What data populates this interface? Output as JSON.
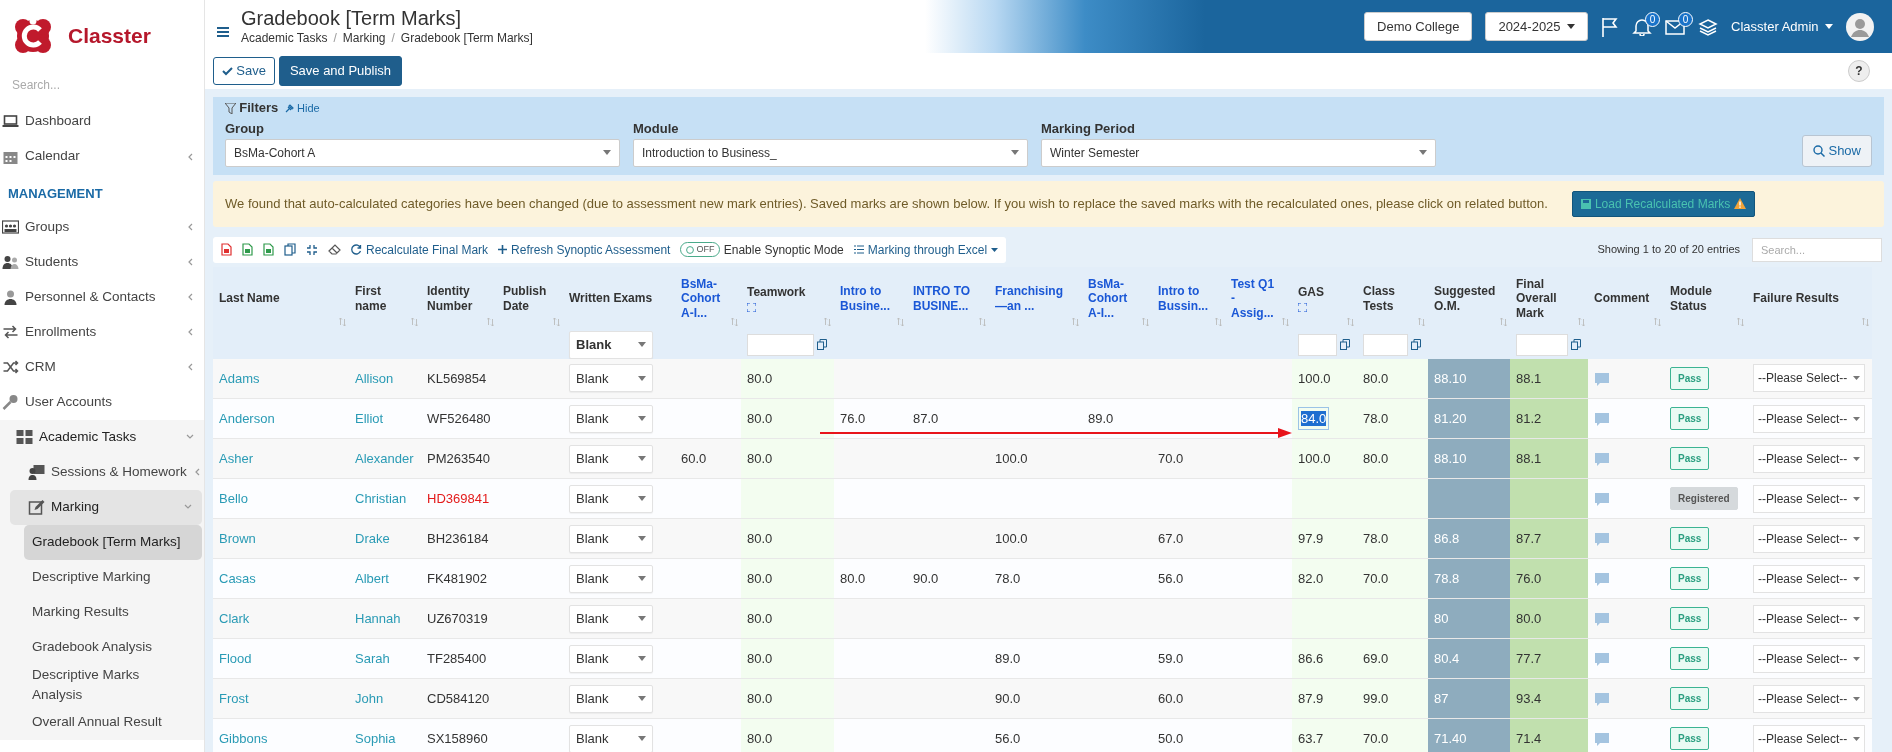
{
  "sidebar": {
    "brand": "Classter",
    "search_placeholder": "Search...",
    "items": [
      {
        "label": "Dashboard",
        "kind": "item",
        "selected": false
      },
      {
        "label": "Calendar",
        "kind": "item",
        "expanded": false,
        "selected": false
      },
      {
        "label": "MANAGEMENT",
        "kind": "section"
      },
      {
        "label": "Groups",
        "kind": "item",
        "expanded": false,
        "selected": false
      },
      {
        "label": "Students",
        "kind": "item",
        "expanded": false,
        "selected": false
      },
      {
        "label": "Personnel & Contacts",
        "kind": "item",
        "expanded": false,
        "selected": false
      },
      {
        "label": "Enrollments",
        "kind": "item",
        "expanded": false,
        "selected": false
      },
      {
        "label": "CRM",
        "kind": "item",
        "expanded": false,
        "selected": false
      },
      {
        "label": "User Accounts",
        "kind": "item",
        "selected": false
      },
      {
        "label": "Academic Tasks",
        "kind": "item",
        "expanded": true,
        "selected": false,
        "children": [
          {
            "label": "Sessions & Homework",
            "kind": "item",
            "expanded": false,
            "selected": false
          },
          {
            "label": "Marking",
            "kind": "item",
            "expanded": true,
            "selected": false,
            "children": [
              {
                "label": "Gradebook [Term Marks]",
                "kind": "item",
                "selected": true
              },
              {
                "label": "Descriptive Marking",
                "kind": "item",
                "selected": false
              },
              {
                "label": "Marking Results",
                "kind": "item",
                "selected": false
              },
              {
                "label": "Gradebook Analysis",
                "kind": "item",
                "selected": false
              },
              {
                "label": "Descriptive Marks Analysis",
                "kind": "item",
                "selected": false
              },
              {
                "label": "Overall Annual Result",
                "kind": "item",
                "selected": false
              }
            ]
          }
        ]
      }
    ]
  },
  "header": {
    "title": "Gradebook [Term Marks]",
    "breadcrumb": [
      {
        "label": "Academic Tasks",
        "separator": "/"
      },
      {
        "label": "Marking",
        "separator": "/"
      },
      {
        "label": "Gradebook [Term Marks]"
      }
    ],
    "college": "Demo College",
    "year": "2024-2025",
    "notifications": "0",
    "messages": "0",
    "user": "Classter Admin"
  },
  "actions": {
    "save": "Save",
    "save_publish": "Save and Publish",
    "help": "?"
  },
  "filters": {
    "title": "Filters",
    "hide": "Hide",
    "fields": [
      {
        "label": "Group",
        "value": "BsMa-Cohort A"
      },
      {
        "label": "Module",
        "value": "Introduction to Business_"
      },
      {
        "label": "Marking Period",
        "value": "Winter Semester"
      }
    ],
    "show": "Show"
  },
  "alert": {
    "text": "We found that auto-calculated categories have been changed (due to assessment new mark entries). Saved marks are shown below. If you wish to replace the saved marks with the recalculated ones, please click on related button.",
    "button": "Load Recalculated Marks"
  },
  "toolbar": {
    "recalculate": "Recalculate Final Mark",
    "refresh": "Refresh Synoptic Assessment",
    "synoptic": {
      "label": "Enable Synoptic Mode",
      "state_text": "OFF",
      "on": false
    },
    "excel": "Marking through Excel",
    "info": "Showing 1 to 20 of 20 entries",
    "search_placeholder": "Search..."
  },
  "table": {
    "columns": [
      {
        "label": "Last Name",
        "kind": "plain",
        "sortable": true,
        "expand": false
      },
      {
        "label": "First name",
        "kind": "plain",
        "sortable": true,
        "expand": false
      },
      {
        "label": "Identity Number",
        "kind": "plain",
        "sortable": true,
        "expand": false
      },
      {
        "label": "Publish Date",
        "kind": "plain",
        "sortable": true,
        "expand": false
      },
      {
        "label": "Written Exams",
        "kind": "plain",
        "sortable": false,
        "expand": false,
        "filter": {
          "kind": "select",
          "value": "Blank"
        }
      },
      {
        "label": "BsMa-Cohort A-I...",
        "kind": "link",
        "sortable": true,
        "expand": false
      },
      {
        "label": "Teamwork",
        "kind": "graded",
        "sortable": true,
        "expand": true,
        "filter": {
          "kind": "input"
        }
      },
      {
        "label": "Intro to Busine...",
        "kind": "link",
        "sortable": true,
        "expand": false
      },
      {
        "label": "INTRO TO BUSINE...",
        "kind": "link",
        "sortable": true,
        "expand": false
      },
      {
        "label": "Franchising —an ...",
        "kind": "link",
        "sortable": true,
        "expand": false
      },
      {
        "label": "BsMa-Cohort A-I...",
        "kind": "link",
        "sortable": true,
        "expand": false
      },
      {
        "label": "Intro to Bussin...",
        "kind": "link",
        "sortable": true,
        "expand": false
      },
      {
        "label": "Test Q1 - Assig...",
        "kind": "link",
        "sortable": true,
        "expand": false
      },
      {
        "label": "GAS",
        "kind": "graded",
        "sortable": true,
        "expand": true,
        "filter": {
          "kind": "input"
        }
      },
      {
        "label": "Class Tests",
        "kind": "graded",
        "sortable": true,
        "expand": false,
        "filter": {
          "kind": "input"
        }
      },
      {
        "label": "Suggested O.M.",
        "kind": "suggested",
        "sortable": true,
        "expand": false
      },
      {
        "label": "Final Overall Mark",
        "kind": "final",
        "sortable": true,
        "expand": false,
        "filter": {
          "kind": "input"
        }
      },
      {
        "label": "Comment",
        "kind": "plain",
        "sortable": true,
        "expand": false
      },
      {
        "label": "Module Status",
        "kind": "plain",
        "sortable": true,
        "expand": false
      },
      {
        "label": "Failure Results",
        "kind": "plain",
        "sortable": true,
        "expand": false
      }
    ],
    "rows": [
      {
        "last_name": "Adams",
        "first_name": "Allison",
        "identity": "KL569854",
        "identity_flagged": false,
        "written": "Blank",
        "marks": {
          "teamwork": "80.0",
          "gas": "100.0",
          "class_tests": "80.0"
        },
        "gas_focused": false,
        "annotated": false,
        "suggested": "88.10",
        "final": "88.1",
        "status": {
          "text": "Pass",
          "kind": "pass"
        },
        "failure": "--Please Select--"
      },
      {
        "last_name": "Anderson",
        "first_name": "Elliot",
        "identity": "WF526480",
        "identity_flagged": false,
        "written": "Blank",
        "marks": {
          "teamwork": "80.0",
          "intro_to_busine": "76.0",
          "intro_to_busine_upper": "87.0",
          "bsma_cohort_a_second": "89.0",
          "gas": "84.0",
          "class_tests": "78.0"
        },
        "gas_focused": true,
        "annotated": true,
        "suggested": "81.20",
        "final": "81.2",
        "status": {
          "text": "Pass",
          "kind": "pass"
        },
        "failure": "--Please Select--"
      },
      {
        "last_name": "Asher",
        "first_name": "Alexander",
        "identity": "PM263540",
        "identity_flagged": false,
        "written": "Blank",
        "marks": {
          "bsma_cohort_a": "60.0",
          "teamwork": "80.0",
          "franchising": "100.0",
          "intro_to_bussin": "70.0",
          "gas": "100.0",
          "class_tests": "80.0"
        },
        "gas_focused": false,
        "annotated": false,
        "suggested": "88.10",
        "final": "88.1",
        "status": {
          "text": "Pass",
          "kind": "pass"
        },
        "failure": "--Please Select--"
      },
      {
        "last_name": "Bello",
        "first_name": "Christian",
        "identity": "HD369841",
        "identity_flagged": true,
        "written": "Blank",
        "gas_focused": false,
        "annotated": false,
        "status": {
          "text": "Registered",
          "kind": "registered"
        },
        "failure": "--Please Select--"
      },
      {
        "last_name": "Brown",
        "first_name": "Drake",
        "identity": "BH236184",
        "identity_flagged": false,
        "written": "Blank",
        "marks": {
          "teamwork": "80.0",
          "franchising": "100.0",
          "intro_to_bussin": "67.0",
          "gas": "97.9",
          "class_tests": "78.0"
        },
        "gas_focused": false,
        "annotated": false,
        "suggested": "86.8",
        "final": "87.7",
        "status": {
          "text": "Pass",
          "kind": "pass"
        },
        "failure": "--Please Select--"
      },
      {
        "last_name": "Casas",
        "first_name": "Albert",
        "identity": "FK481902",
        "identity_flagged": false,
        "written": "Blank",
        "marks": {
          "teamwork": "80.0",
          "intro_to_busine": "80.0",
          "intro_to_busine_upper": "90.0",
          "franchising": "78.0",
          "intro_to_bussin": "56.0",
          "gas": "82.0",
          "class_tests": "70.0"
        },
        "gas_focused": false,
        "annotated": false,
        "suggested": "78.8",
        "final": "76.0",
        "status": {
          "text": "Pass",
          "kind": "pass"
        },
        "failure": "--Please Select--"
      },
      {
        "last_name": "Clark",
        "first_name": "Hannah",
        "identity": "UZ670319",
        "identity_flagged": false,
        "written": "Blank",
        "marks": {
          "teamwork": "80.0"
        },
        "gas_focused": false,
        "annotated": false,
        "suggested": "80",
        "final": "80.0",
        "status": {
          "text": "Pass",
          "kind": "pass"
        },
        "failure": "--Please Select--"
      },
      {
        "last_name": "Flood",
        "first_name": "Sarah",
        "identity": "TF285400",
        "identity_flagged": false,
        "written": "Blank",
        "marks": {
          "teamwork": "80.0",
          "franchising": "89.0",
          "intro_to_bussin": "59.0",
          "gas": "86.6",
          "class_tests": "69.0"
        },
        "gas_focused": false,
        "annotated": false,
        "suggested": "80.4",
        "final": "77.7",
        "status": {
          "text": "Pass",
          "kind": "pass"
        },
        "failure": "--Please Select--"
      },
      {
        "last_name": "Frost",
        "first_name": "John",
        "identity": "CD584120",
        "identity_flagged": false,
        "written": "Blank",
        "marks": {
          "teamwork": "80.0",
          "franchising": "90.0",
          "intro_to_bussin": "60.0",
          "gas": "87.9",
          "class_tests": "99.0"
        },
        "gas_focused": false,
        "annotated": false,
        "suggested": "87",
        "final": "93.4",
        "status": {
          "text": "Pass",
          "kind": "pass"
        },
        "failure": "--Please Select--"
      },
      {
        "last_name": "Gibbons",
        "first_name": "Sophia",
        "identity": "SX158960",
        "identity_flagged": false,
        "written": "Blank",
        "marks": {
          "teamwork": "80.0",
          "franchising": "56.0",
          "intro_to_bussin": "50.0",
          "gas": "63.7",
          "class_tests": "70.0"
        },
        "gas_focused": false,
        "annotated": false,
        "suggested": "71.40",
        "final": "71.4",
        "status": {
          "text": "Pass",
          "kind": "pass"
        },
        "failure": "--Please Select--"
      }
    ]
  }
}
